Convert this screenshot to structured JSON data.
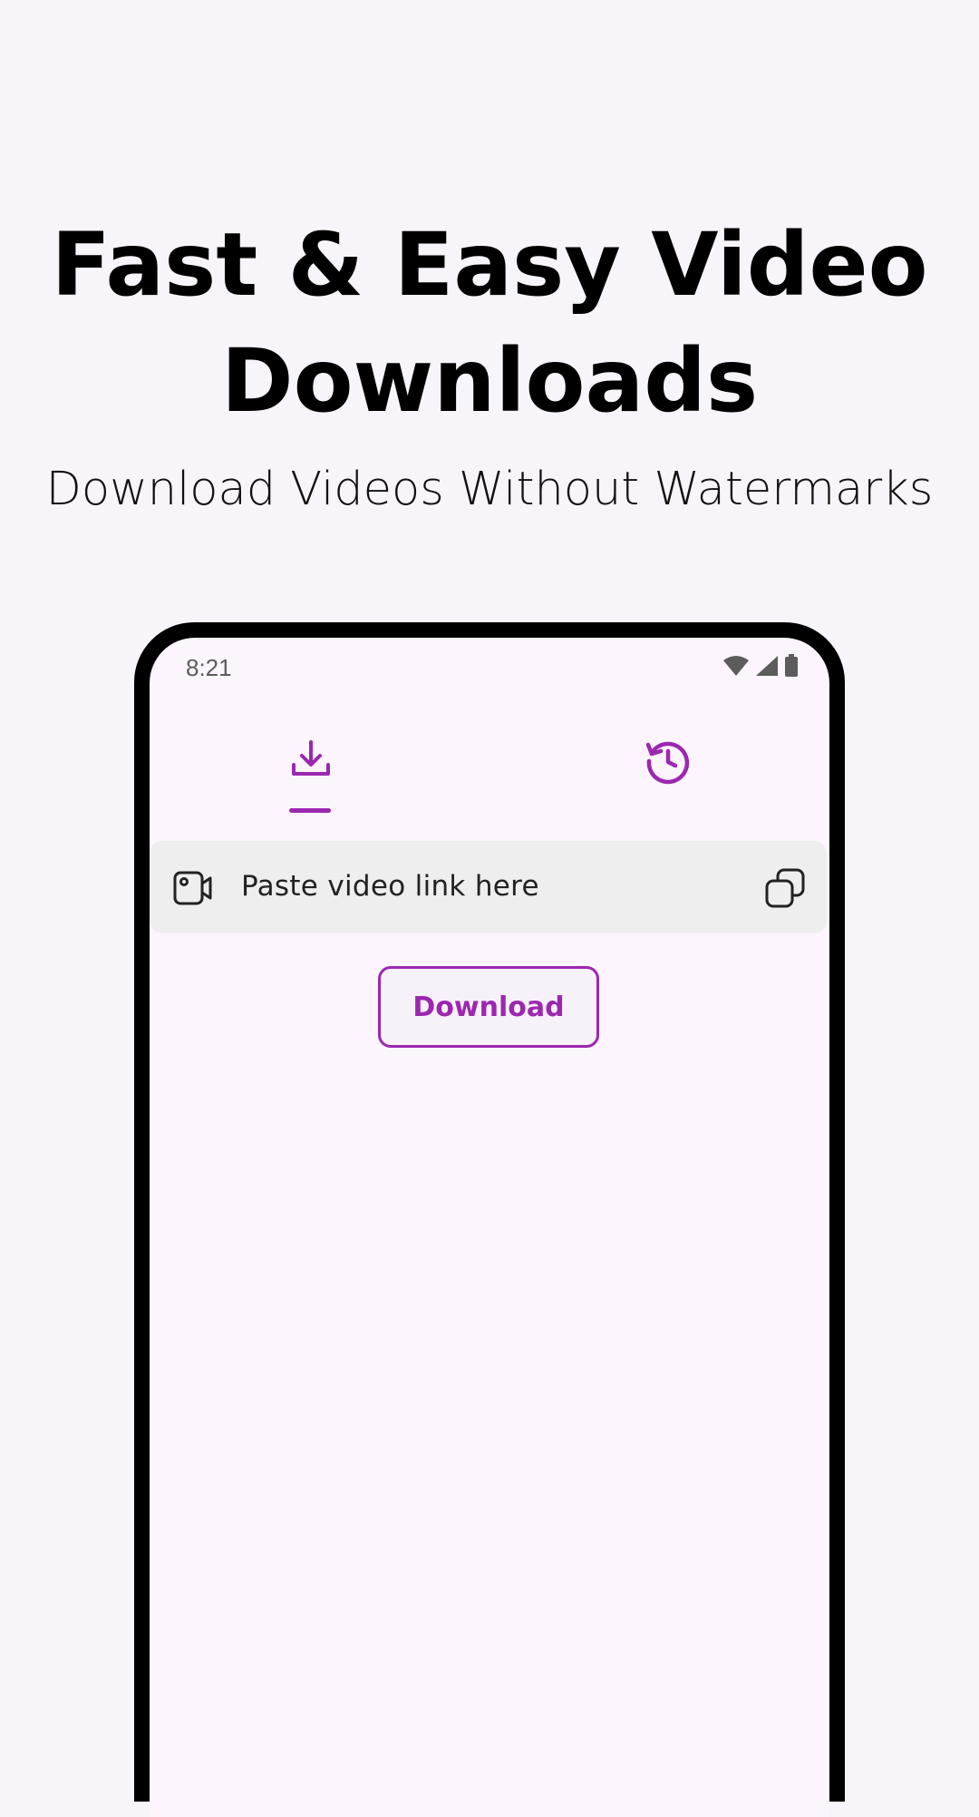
{
  "hero": {
    "title": "Fast & Easy Video Downloads",
    "subtitle": "Download Videos Without Watermarks"
  },
  "phone": {
    "status_bar": {
      "time": "8:21",
      "icons": [
        "wifi-icon",
        "signal-icon",
        "battery-icon"
      ]
    },
    "tabs": [
      {
        "name": "download",
        "icon": "download-icon",
        "active": true
      },
      {
        "name": "history",
        "icon": "history-icon",
        "active": false
      }
    ],
    "link_input": {
      "placeholder": "Paste video link here",
      "leading_icon": "video-icon",
      "trailing_icon": "paste-icon"
    },
    "download_button": {
      "label": "Download"
    }
  },
  "colors": {
    "accent": "#9c27b0",
    "page_background": "#f8f5fa",
    "screen_background": "#fcf5fd",
    "input_background": "#eeeeee",
    "phone_frame": "#000000"
  }
}
